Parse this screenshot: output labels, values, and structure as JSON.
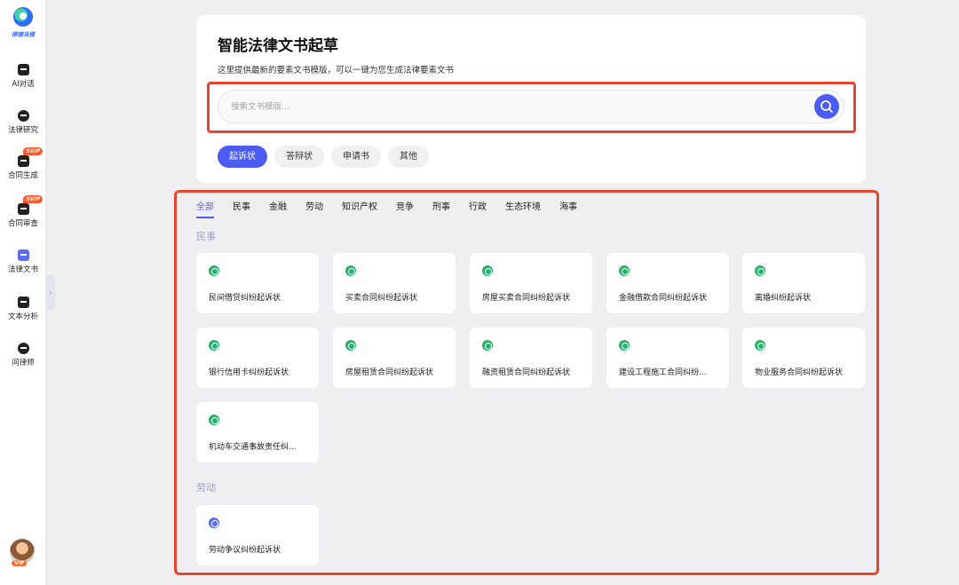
{
  "sidebar": {
    "brand": "得理法搜",
    "items": [
      {
        "label": "AI对话",
        "icon": "chat-icon",
        "badge": ""
      },
      {
        "label": "法律研究",
        "icon": "research-icon",
        "badge": ""
      },
      {
        "label": "合同生成",
        "icon": "contract-generate-icon",
        "badge": "SVIP"
      },
      {
        "label": "合同审查",
        "icon": "contract-review-icon",
        "badge": "SVIP"
      },
      {
        "label": "法律文书",
        "icon": "legal-doc-icon",
        "badge": ""
      },
      {
        "label": "文本分析",
        "icon": "text-analysis-icon",
        "badge": ""
      },
      {
        "label": "问律师",
        "icon": "lawyer-icon",
        "badge": ""
      }
    ],
    "avatar_badge": "VIP"
  },
  "header": {
    "title": "智能法律文书起草",
    "subtitle": "这里提供最新的要素文书模版，可以一键为您生成法律要素文书",
    "search_placeholder": "搜索文书模版...",
    "doc_types": [
      "起诉状",
      "答辩状",
      "申请书",
      "其他"
    ],
    "active_doc_type": "起诉状"
  },
  "categories": [
    "全部",
    "民事",
    "金融",
    "劳动",
    "知识产权",
    "竞争",
    "刑事",
    "行政",
    "生态环境",
    "海事"
  ],
  "active_category": "全部",
  "sections": [
    {
      "title": "民事",
      "items": [
        "民间借贷纠纷起诉状",
        "买卖合同纠纷起诉状",
        "房屋买卖合同纠纷起诉状",
        "金融借款合同纠纷起诉状",
        "离婚纠纷起诉状",
        "银行信用卡纠纷起诉状",
        "房屋租赁合同纠纷起诉状",
        "融资租赁合同纠纷起诉状",
        "建设工程施工合同纠纷...",
        "物业服务合同纠纷起诉状",
        "机动车交通事故责任纠..."
      ]
    },
    {
      "title": "劳动",
      "items": [
        "劳动争议纠纷起诉状"
      ]
    }
  ],
  "colors": {
    "accent": "#4c5cf2",
    "highlight_outline": "#e8452f",
    "icon_green": "#24b36b"
  }
}
